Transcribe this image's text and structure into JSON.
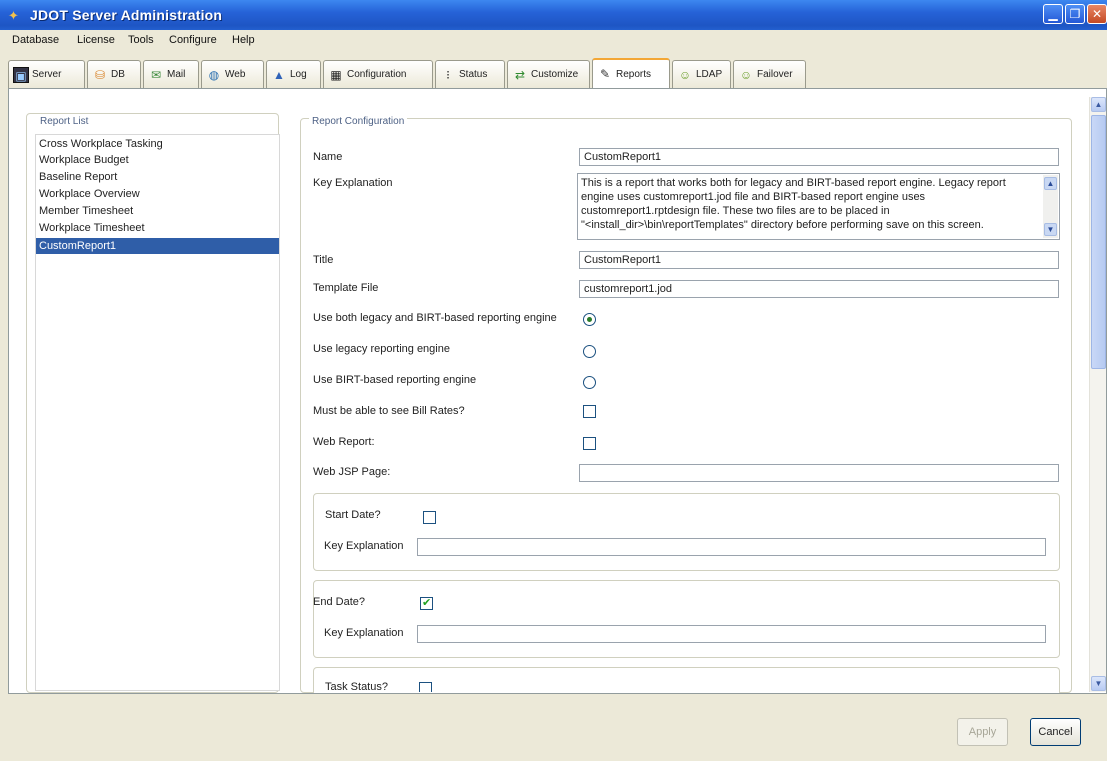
{
  "window": {
    "title": "JDOT Server Administration"
  },
  "menu": [
    {
      "name": "menu-database",
      "label": "Database"
    },
    {
      "name": "menu-license",
      "label": "License"
    },
    {
      "name": "menu-tools",
      "label": "Tools"
    },
    {
      "name": "menu-configure",
      "label": "Configure"
    },
    {
      "name": "menu-help",
      "label": "Help"
    }
  ],
  "tabs": [
    {
      "name": "tab-server",
      "label": "Server",
      "icon": "monitor-icon"
    },
    {
      "name": "tab-db",
      "label": "DB",
      "icon": "database-icon"
    },
    {
      "name": "tab-mail",
      "label": "Mail",
      "icon": "mail-icon"
    },
    {
      "name": "tab-web",
      "label": "Web",
      "icon": "globe-icon"
    },
    {
      "name": "tab-log",
      "label": "Log",
      "icon": "chart-icon"
    },
    {
      "name": "tab-configuration",
      "label": "Configuration",
      "icon": "calendar-icon"
    },
    {
      "name": "tab-status",
      "label": "Status",
      "icon": "traffic-light-icon"
    },
    {
      "name": "tab-customize",
      "label": "Customize",
      "icon": "arrows-icon"
    },
    {
      "name": "tab-reports",
      "label": "Reports",
      "icon": "report-icon",
      "active": true
    },
    {
      "name": "tab-ldap",
      "label": "LDAP",
      "icon": "people-icon"
    },
    {
      "name": "tab-failover",
      "label": "Failover",
      "icon": "people-icon"
    }
  ],
  "report_list": {
    "title": "Report List",
    "items": [
      "Cross Workplace Tasking",
      "Workplace Budget",
      "Baseline Report",
      "Workplace Overview",
      "Member Timesheet",
      "Workplace Timesheet",
      "CustomReport1"
    ],
    "selected": "CustomReport1"
  },
  "config": {
    "title": "Report Configuration",
    "name_label": "Name",
    "name_value": "CustomReport1",
    "key_explanation_label": "Key Explanation",
    "key_explanation_lines": [
      "This is a report that works both for legacy and  BIRT-based report engine. Legacy report",
      "engine uses customreport1.jod file  and BIRT-based report engine uses",
      "customreport1.rptdesign file. These two files are to be placed in",
      "\"<install_dir>\\bin\\reportTemplates\" directory before performing save on this screen."
    ],
    "title_label": "Title",
    "title_value": "CustomReport1",
    "template_label": "Template File",
    "template_value": "customreport1.jod",
    "engine_both_label": "Use both legacy and BIRT-based reporting engine",
    "engine_legacy_label": "Use legacy reporting engine",
    "engine_birt_label": "Use BIRT-based reporting engine",
    "engine_selected": "both",
    "bill_rates_label": "Must be able to see Bill Rates?",
    "bill_rates_checked": false,
    "web_report_label": "Web Report:",
    "web_report_checked": false,
    "web_jsp_label": "Web JSP Page:",
    "web_jsp_value": "",
    "start_date_label": "Start Date?",
    "start_date_checked": false,
    "start_key_label": "Key Explanation",
    "start_key_value": "",
    "end_date_label": "End Date?",
    "end_date_checked": true,
    "end_key_label": "Key Explanation",
    "end_key_value": "",
    "task_status_label": "Task Status?",
    "task_status_checked": false
  },
  "buttons": {
    "apply": "Apply",
    "cancel": "Cancel",
    "apply_enabled": false
  }
}
